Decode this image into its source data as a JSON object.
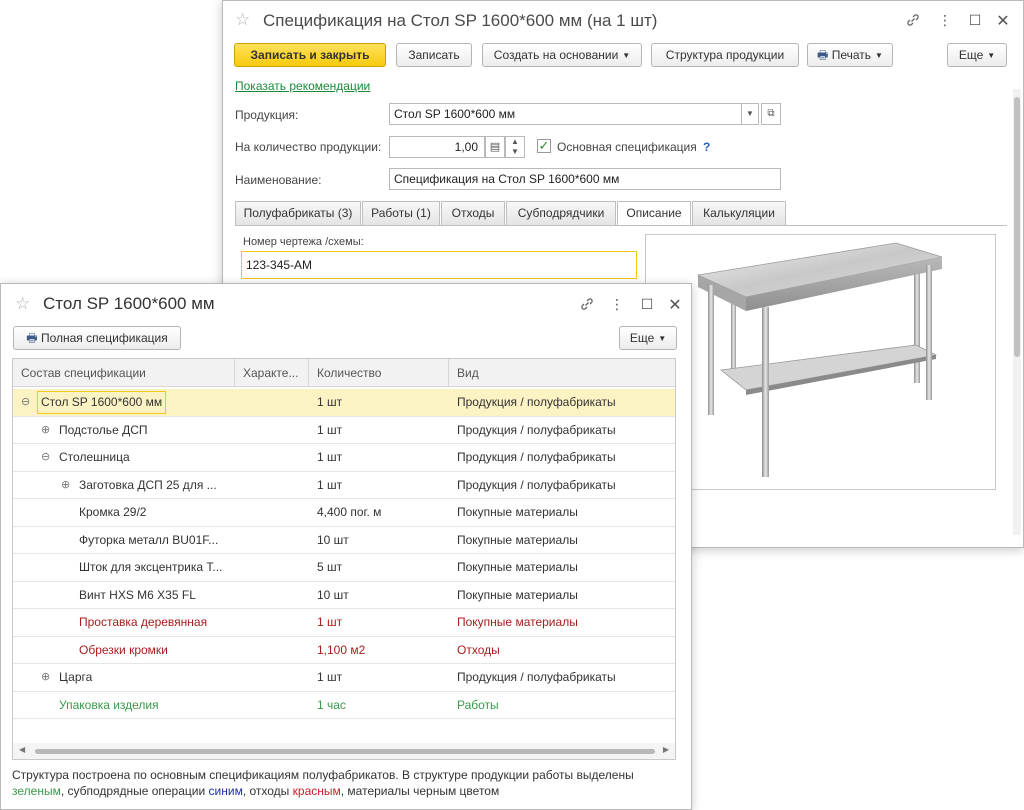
{
  "back_window": {
    "title": "Спецификация на Стол SP 1600*600 мм (на 1 шт)",
    "toolbar": {
      "save_close": "Записать и закрыть",
      "save": "Записать",
      "create_based": "Создать на основании",
      "structure": "Структура продукции",
      "print": "Печать",
      "more": "Еще"
    },
    "recommendations_link": "Показать рекомендации",
    "fields": {
      "product_label": "Продукция:",
      "product_value": "Стол SP 1600*600 мм",
      "qty_label": "На количество продукции:",
      "qty_value": "1,00",
      "main_spec_label": "Основная спецификация",
      "help": "?",
      "name_label": "Наименование:",
      "name_value": "Спецификация на Стол SP 1600*600 мм"
    },
    "tabs": [
      "Полуфабрикаты (3)",
      "Работы (1)",
      "Отходы",
      "Субподрядчики",
      "Описание",
      "Калькуляции"
    ],
    "active_tab": "Описание",
    "drawing_label": "Номер чертежа /схемы:",
    "drawing_value": "123-345-АМ"
  },
  "front_window": {
    "title": "Стол SP 1600*600 мм",
    "toolbar": {
      "full_spec": "Полная спецификация",
      "more": "Еще"
    },
    "columns": [
      "Состав спецификации",
      "Характе...",
      "Количество",
      "Вид"
    ],
    "rows": [
      {
        "expander": "⊖",
        "name": "Стол SP 1600*600 мм",
        "char": "",
        "qty": "1 шт",
        "kind": "Продукция / полуфабрикаты",
        "level": 0,
        "color": "normal",
        "selected": true
      },
      {
        "expander": "⊕",
        "name": "Подстолье ДСП",
        "char": "",
        "qty": "1 шт",
        "kind": "Продукция / полуфабрикаты",
        "level": 1,
        "color": "normal"
      },
      {
        "expander": "⊖",
        "name": "Столешница",
        "char": "",
        "qty": "1 шт",
        "kind": "Продукция / полуфабрикаты",
        "level": 1,
        "color": "normal"
      },
      {
        "expander": "⊕",
        "name": "Заготовка ДСП 25 для ...",
        "char": "",
        "qty": "1 шт",
        "kind": "Продукция / полуфабрикаты",
        "level": 2,
        "color": "normal"
      },
      {
        "expander": "",
        "name": "Кромка 29/2",
        "char": "",
        "qty": "4,400 пог. м",
        "kind": "Покупные материалы",
        "level": 2,
        "color": "normal"
      },
      {
        "expander": "",
        "name": "Футорка металл BU01F...",
        "char": "",
        "qty": "10 шт",
        "kind": "Покупные материалы",
        "level": 2,
        "color": "normal"
      },
      {
        "expander": "",
        "name": "Шток для эксцентрика Т...",
        "char": "",
        "qty": "5 шт",
        "kind": "Покупные материалы",
        "level": 2,
        "color": "normal"
      },
      {
        "expander": "",
        "name": "Винт HXS M6 X35 FL",
        "char": "",
        "qty": "10 шт",
        "kind": "Покупные материалы",
        "level": 2,
        "color": "normal"
      },
      {
        "expander": "",
        "name": "Проставка деревянная",
        "char": "",
        "qty": "1 шт",
        "kind": "Покупные материалы",
        "level": 2,
        "color": "red"
      },
      {
        "expander": "",
        "name": "Обрезки кромки",
        "char": "",
        "qty": "1,100 м2",
        "kind": "Отходы",
        "level": 2,
        "color": "red"
      },
      {
        "expander": "⊕",
        "name": "Царга",
        "char": "",
        "qty": "1 шт",
        "kind": "Продукция / полуфабрикаты",
        "level": 1,
        "color": "normal"
      },
      {
        "expander": "",
        "name": "Упаковка изделия",
        "char": "",
        "qty": "1 час",
        "kind": "Работы",
        "level": 1,
        "color": "green"
      }
    ],
    "footer": {
      "part1": "Структура построена по основным спецификациям полуфабрикатов. В структуре продукции работы выделены ",
      "green_word": "зеленым",
      "part2": ", субподрядные операции ",
      "blue_word": "синим",
      "part3": ", отходы ",
      "red_word": "красным",
      "part4": ", материалы черным цветом"
    }
  },
  "colors": {
    "accent_yellow": "#f7c90e",
    "selection": "#fcf3c5",
    "work_green": "#3a9a4a",
    "waste_red": "#a81d1d",
    "subcontract_blue": "#1f2fa8"
  }
}
